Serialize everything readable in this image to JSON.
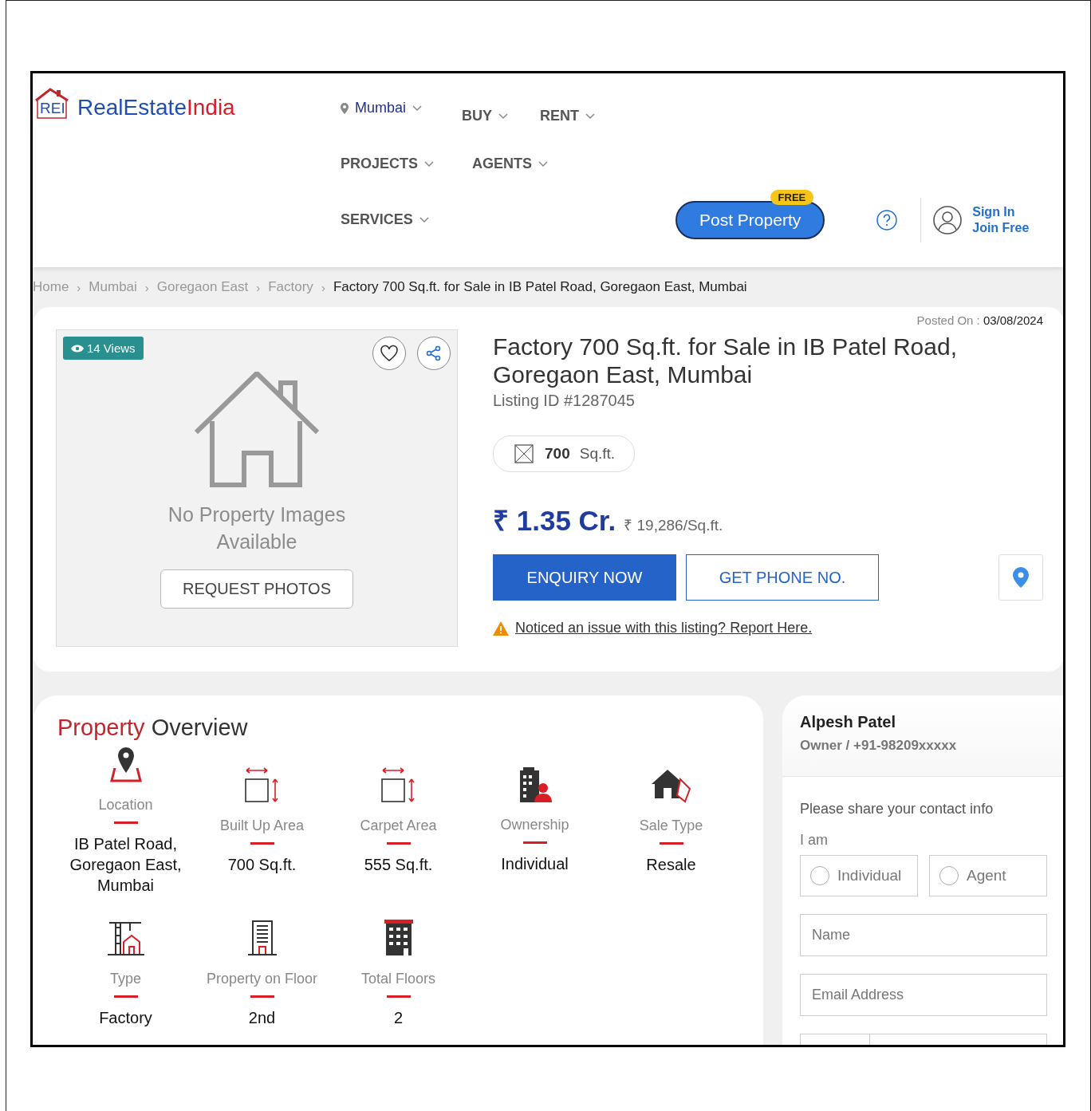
{
  "header": {
    "logo": {
      "badge": "REI",
      "brand": "RealEstate",
      "brand_accent": "India"
    },
    "location": {
      "label": "Mumbai"
    },
    "nav": [
      {
        "label": "BUY"
      },
      {
        "label": "RENT"
      },
      {
        "label": "PROJECTS"
      },
      {
        "label": "AGENTS"
      },
      {
        "label": "SERVICES"
      }
    ],
    "post_property": {
      "label": "Post Property",
      "badge": "FREE"
    },
    "sign_in": "Sign In",
    "join": "Join Free"
  },
  "breadcrumb": [
    {
      "label": "Home"
    },
    {
      "separator": "›",
      "label": "Mumbai"
    },
    {
      "separator": "›",
      "label": "Goregaon East"
    },
    {
      "separator": "›",
      "label": "Factory"
    },
    {
      "separator": "›",
      "label": "Factory 700 Sq.ft. for Sale in IB Patel Road, Goregaon East, Mumbai"
    }
  ],
  "listing": {
    "views": "14 Views",
    "no_images": "No Property Images Available",
    "request_button": "REQUEST PHOTOS",
    "posted_label": "Posted On :",
    "posted_date": "03/08/2024",
    "title": "Factory 700 Sq.ft. for Sale in IB Patel Road, Goregaon East, Mumbai",
    "listing_id": "Listing ID #1287045",
    "area_value": "700",
    "area_unit": "Sq.ft.",
    "price": "₹ 1.35 Cr.",
    "price_per_unit": "₹ 19,286/Sq.ft.",
    "enquiry_button": "ENQUIRY NOW",
    "phone_button": "GET PHONE NO.",
    "report_link": "Noticed an issue with this listing? Report Here."
  },
  "overview": {
    "title_1": "Property",
    "title_2": "Overview",
    "items": [
      {
        "label": "Location",
        "value": "IB Patel Road, Goregaon East, Mumbai"
      },
      {
        "label": "Built Up Area",
        "value": "700 Sq.ft."
      },
      {
        "label": "Carpet Area",
        "value": "555 Sq.ft."
      },
      {
        "label": "Ownership",
        "value": "Individual"
      },
      {
        "label": "Sale Type",
        "value": "Resale"
      },
      {
        "label": "Type",
        "value": "Factory"
      },
      {
        "label": "Property on Floor",
        "value": "2nd"
      },
      {
        "label": "Total Floors",
        "value": "2"
      }
    ]
  },
  "contact": {
    "name": "Alpesh Patel",
    "subtitle": "Owner / +91-98209xxxxx",
    "prompt": "Please share your contact info",
    "i_am": "I am",
    "roles": [
      {
        "label": "Individual",
        "selected": false
      },
      {
        "label": "Agent",
        "selected": false
      }
    ],
    "fields": [
      {
        "placeholder": "Name"
      },
      {
        "placeholder": "Email Address"
      }
    ]
  }
}
